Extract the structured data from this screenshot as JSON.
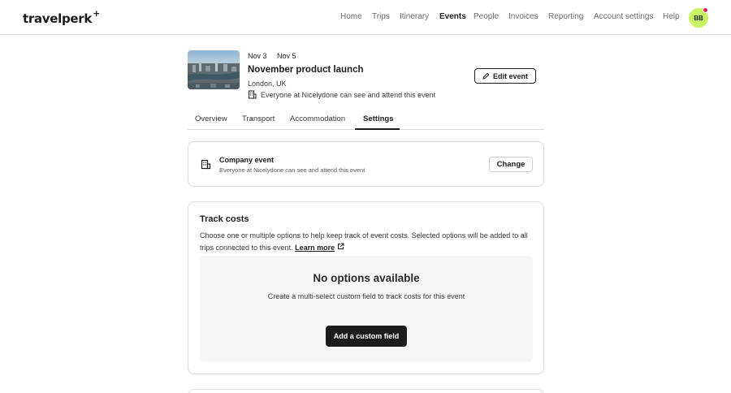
{
  "header": {
    "logo_text": "travelperk",
    "logo_mark": "+",
    "nav": [
      {
        "label": "Home",
        "active": false
      },
      {
        "label": "Trips",
        "active": false
      },
      {
        "label": "Itinerary",
        "active": false
      },
      {
        "label": "Events",
        "active": true
      },
      {
        "label": "People",
        "active": false
      },
      {
        "label": "Invoices",
        "active": false
      },
      {
        "label": "Reporting",
        "active": false
      },
      {
        "label": "Account settings",
        "active": false
      },
      {
        "label": "Help",
        "active": false
      }
    ],
    "avatar_initials": "BB",
    "notification_color": "#e0245e",
    "avatar_color": "#c6f263"
  },
  "event": {
    "start_date": "Nov 3",
    "end_date": "Nov 5",
    "title": "November product launch",
    "location": "London, UK",
    "visibility": "Everyone at Nicelydone can see and attend this event",
    "edit_label": "Edit event",
    "image_icon": "london-skyline-thumbnail"
  },
  "tabs": [
    {
      "label": "Overview",
      "active": false
    },
    {
      "label": "Transport",
      "active": false
    },
    {
      "label": "Accommodation",
      "active": false
    },
    {
      "label": "Settings",
      "active": true
    }
  ],
  "event_type_card": {
    "icon": "building-icon",
    "title": "Company event",
    "subtitle": "Everyone at Nicelydone can see and attend this event",
    "change_label": "Change"
  },
  "track_costs": {
    "title": "Track costs",
    "description": "Choose one or multiple options to help keep track of event costs. Selected options will be added to all trips connected to this event.",
    "learn_more": "Learn more",
    "empty_title": "No options available",
    "empty_description": "Create a multi-select custom field to track costs for this event",
    "add_label": "Add a custom field"
  },
  "colors": {
    "primary_text": "#1c1c1c",
    "border": "#dcdcdc",
    "empty_bg": "#f6f6f6"
  }
}
